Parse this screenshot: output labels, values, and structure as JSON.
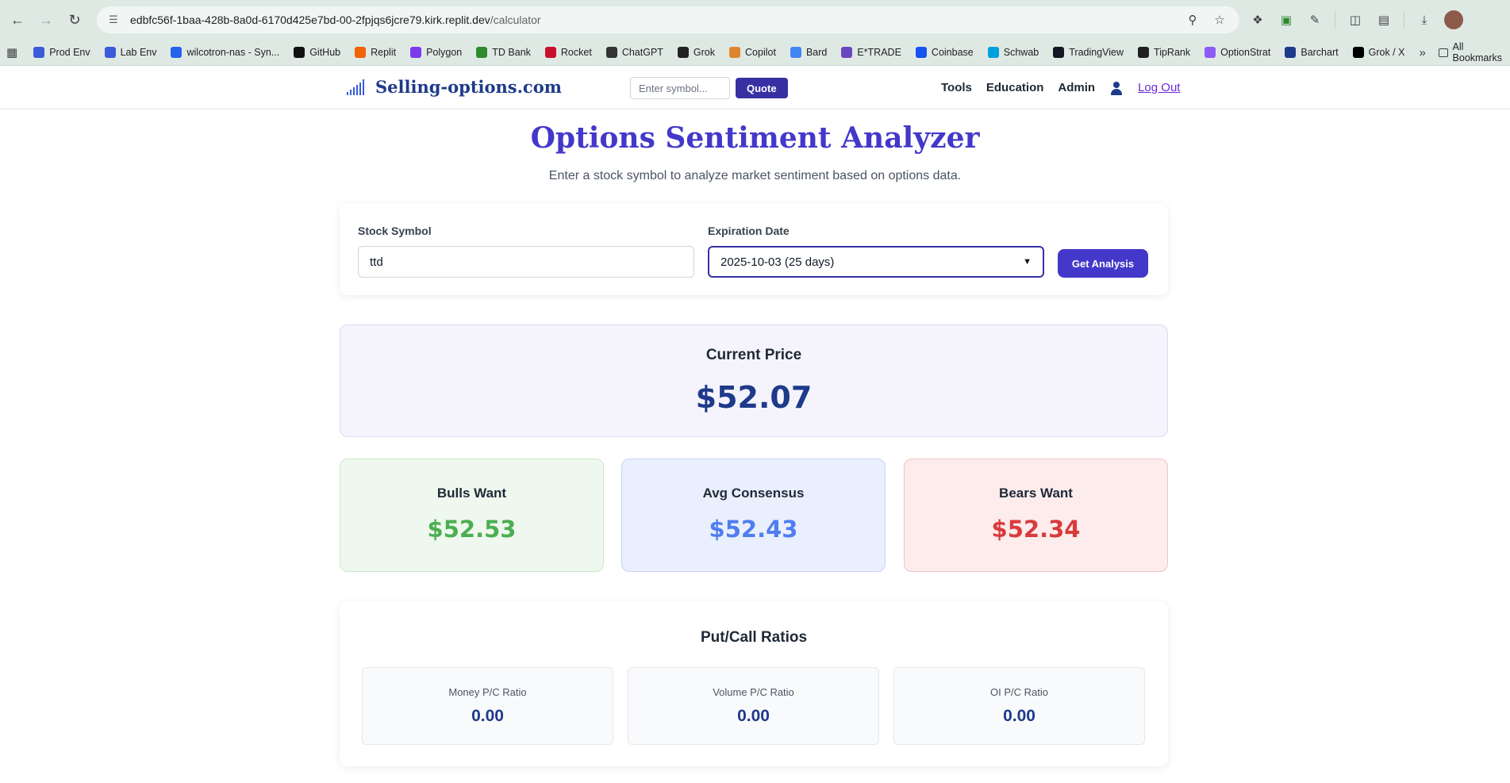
{
  "browser": {
    "url_main": "edbfc56f-1baa-428b-8a0d-6170d425e7bd-00-2fpjqs6jcre79.kirk.replit.dev",
    "url_path": "/calculator",
    "bookmarks": [
      {
        "label": "Prod Env",
        "icon": "so-icon",
        "color": "#3b5bdb"
      },
      {
        "label": "Lab Env",
        "icon": "lab-icon",
        "color": "#3b5bdb"
      },
      {
        "label": "wilcotron-nas - Syn...",
        "icon": "dsm-icon",
        "color": "#2563eb"
      },
      {
        "label": "GitHub",
        "icon": "github-icon",
        "color": "#111111"
      },
      {
        "label": "Replit",
        "icon": "replit-icon",
        "color": "#f26207"
      },
      {
        "label": "Polygon",
        "icon": "polygon-icon",
        "color": "#7c3aed"
      },
      {
        "label": "TD Bank",
        "icon": "td-icon",
        "color": "#2d8a2d"
      },
      {
        "label": "Rocket",
        "icon": "rocket-icon",
        "color": "#c8102e"
      },
      {
        "label": "ChatGPT",
        "icon": "chatgpt-icon",
        "color": "#333333"
      },
      {
        "label": "Grok",
        "icon": "grok-icon",
        "color": "#222222"
      },
      {
        "label": "Copilot",
        "icon": "copilot-icon",
        "color": "#e0852e"
      },
      {
        "label": "Bard",
        "icon": "bard-icon",
        "color": "#4285f4"
      },
      {
        "label": "E*TRADE",
        "icon": "etrade-icon",
        "color": "#6b46c1"
      },
      {
        "label": "Coinbase",
        "icon": "coinbase-icon",
        "color": "#1652f0"
      },
      {
        "label": "Schwab",
        "icon": "schwab-icon",
        "color": "#00a0df"
      },
      {
        "label": "TradingView",
        "icon": "tradingview-icon",
        "color": "#131722"
      },
      {
        "label": "TipRank",
        "icon": "tiprank-icon",
        "color": "#1f1f1f"
      },
      {
        "label": "OptionStrat",
        "icon": "optionstrat-icon",
        "color": "#8b5cf6"
      },
      {
        "label": "Barchart",
        "icon": "barchart-icon",
        "color": "#1e3a8a"
      },
      {
        "label": "Grok / X",
        "icon": "x-icon",
        "color": "#000000"
      }
    ],
    "all_bookmarks": "All Bookmarks"
  },
  "header": {
    "logo_text": "Selling-options.com",
    "search_placeholder": "Enter symbol...",
    "quote_label": "Quote",
    "nav": [
      "Tools",
      "Education",
      "Admin"
    ],
    "logout_label": "Log Out"
  },
  "main": {
    "title": "Options Sentiment Analyzer",
    "subtitle": "Enter a stock symbol to analyze market sentiment based on options data.",
    "form": {
      "symbol_label": "Stock Symbol",
      "symbol_value": "ttd",
      "expiration_label": "Expiration Date",
      "expiration_value": "2025-10-03 (25 days)",
      "button_label": "Get Analysis"
    },
    "current_price": {
      "label": "Current Price",
      "value": "$52.07"
    },
    "sentiment": {
      "bulls": {
        "label": "Bulls Want",
        "value": "$52.53",
        "color": "#4caf50"
      },
      "avg": {
        "label": "Avg Consensus",
        "value": "$52.43",
        "color": "#4f7ef0"
      },
      "bears": {
        "label": "Bears Want",
        "value": "$52.34",
        "color": "#d93b3b"
      }
    },
    "ratios": {
      "title": "Put/Call Ratios",
      "money": {
        "label": "Money P/C Ratio",
        "value": "0.00"
      },
      "volume": {
        "label": "Volume P/C Ratio",
        "value": "0.00"
      },
      "oi": {
        "label": "OI P/C Ratio",
        "value": "0.00"
      }
    }
  }
}
